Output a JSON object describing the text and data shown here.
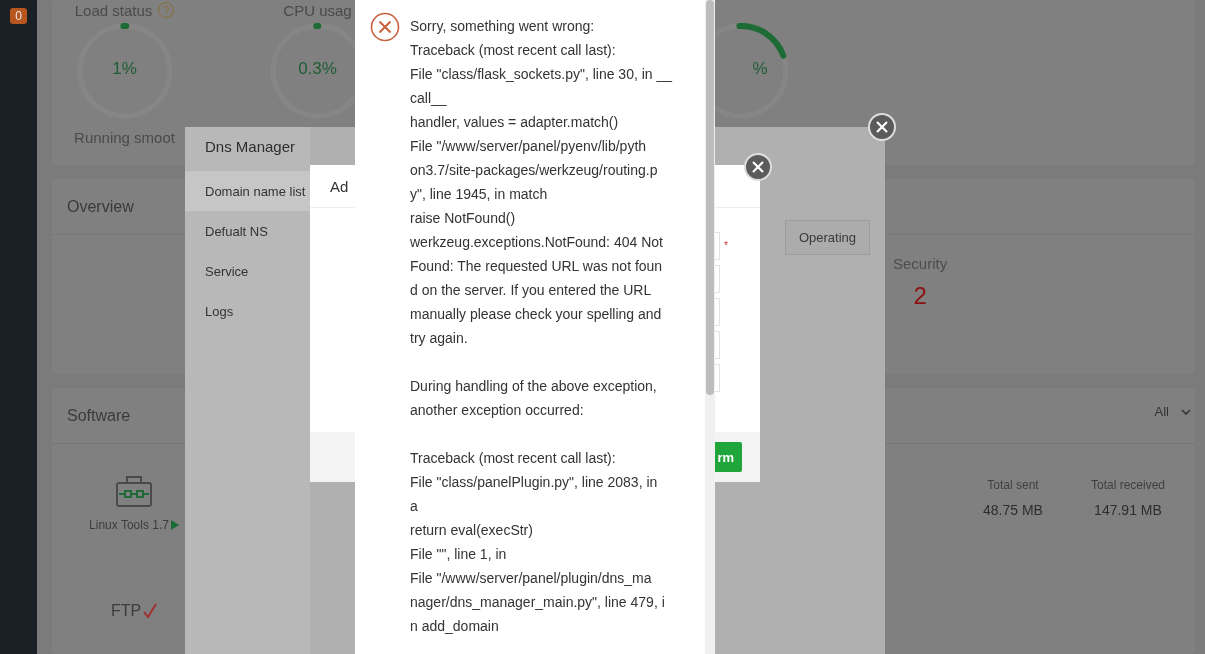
{
  "sidebar": {
    "badge": "0"
  },
  "status": {
    "gauges": [
      {
        "label": "Load status",
        "value": "1%",
        "caption": "Running smoot",
        "help": "?",
        "level": 0.01
      },
      {
        "label": "CPU usag",
        "value": "0.3%",
        "level": 0.003
      },
      {
        "value": "%",
        "level": 0.2
      }
    ]
  },
  "overview": {
    "title": "Overview",
    "items": [
      {
        "label": "Security",
        "value": "2"
      }
    ]
  },
  "software": {
    "title": "Software",
    "apps": [
      {
        "name": "Linux Tools 1.7",
        "kind": "tools"
      },
      {
        "name": "FTP",
        "kind": "ftp"
      }
    ],
    "traffic": {
      "filter": "All",
      "stats": [
        {
          "label": "Total sent",
          "value": "48.75 MB"
        },
        {
          "label": "Total received",
          "value": "147.91 MB"
        }
      ]
    }
  },
  "dns_manager": {
    "title": "Dns Manager",
    "menu": [
      {
        "label": "Domain name list",
        "selected": true
      },
      {
        "label": "Defualt NS",
        "selected": false
      },
      {
        "label": "Service",
        "selected": false
      },
      {
        "label": "Logs",
        "selected": false
      }
    ],
    "operating_label": "Operating"
  },
  "add_dialog": {
    "title": "Ad",
    "fields": [
      {
        "kind": "text",
        "required_mark": "*"
      },
      {
        "kind": "text"
      },
      {
        "kind": "text"
      },
      {
        "kind": "text"
      },
      {
        "kind": "text"
      }
    ],
    "confirm_label": "rm"
  },
  "error_dialog": {
    "blocks": [
      "Sorry, something went wrong:\nTraceback (most recent call last):\nFile \"class/flask_sockets.py\", line 30, in __\ncall__\nhandler, values = adapter.match()\nFile \"/www/server/panel/pyenv/lib/pyth\non3.7/site-packages/werkzeug/routing.p\ny\", line 1945, in match\nraise NotFound()\nwerkzeug.exceptions.NotFound: 404 Not\nFound: The requested URL was not foun\nd on the server. If you entered the URL\nmanually please check your spelling and\ntry again.",
      "During handling of the above exception,\nanother exception occurred:",
      "Traceback (most recent call last):\nFile \"class/panelPlugin.py\", line 2083, in\na\nreturn eval(execStr)\nFile \"\", line 1, in\nFile \"/www/server/panel/plugin/dns_ma\nnager/dns_manager_main.py\", line 479, i\nn add_domain"
    ]
  }
}
